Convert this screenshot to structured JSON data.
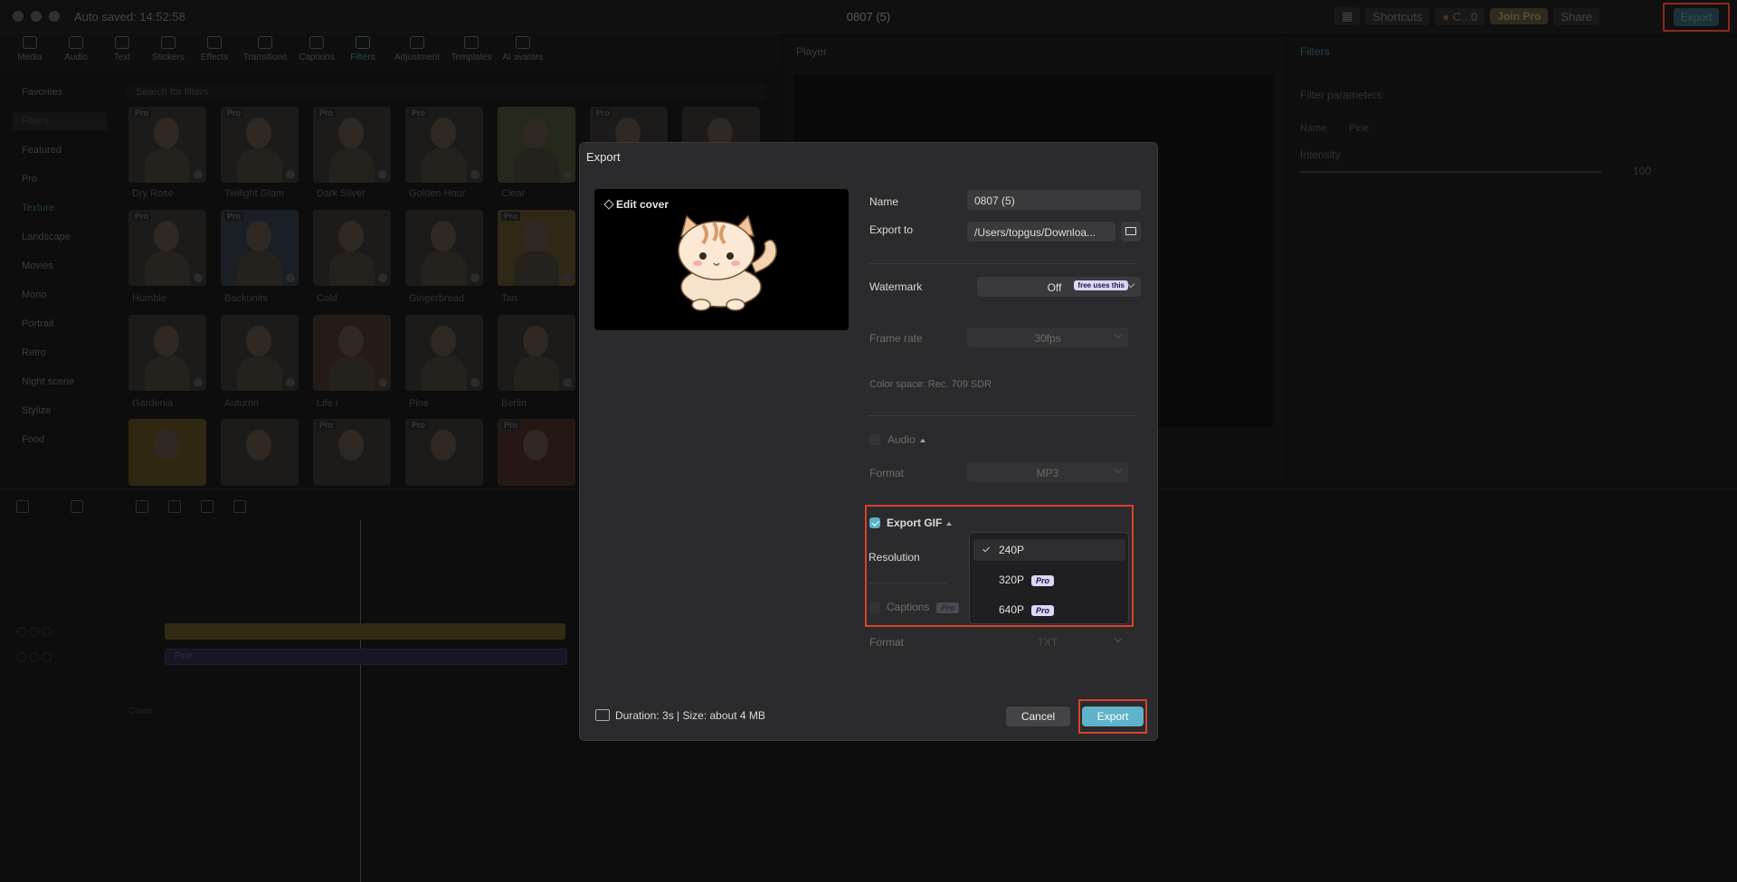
{
  "titlebar": {
    "autosave": "Auto saved: 14:52:58",
    "doc_title": "0807 (5)",
    "shortcuts": "Shortcuts",
    "user": "C...0",
    "join_pro": "Join Pro",
    "share": "Share",
    "export": "Export"
  },
  "toolbar": {
    "tools": [
      "Media",
      "Audio",
      "Text",
      "Stickers",
      "Effects",
      "Transitions",
      "Captions",
      "Filters",
      "Adjustment",
      "Templates",
      "AI avatars"
    ]
  },
  "sidebar": {
    "favorites": "Favorites",
    "filters": "Filters",
    "items": [
      "Featured",
      "Pro",
      "Texture",
      "Landscape",
      "Movies",
      "Mono",
      "Portrait",
      "Retro",
      "Night scene",
      "Stylize",
      "Food"
    ]
  },
  "search": {
    "placeholder": "Search for filters"
  },
  "filter_thumbs": {
    "labels": [
      "Dry Rose",
      "Twilight Glam",
      "Dark Silver",
      "Golden Hour",
      "Clear",
      "Humble",
      "Backunits",
      "Cold",
      "Gingerbread",
      "Tan",
      "Gardenia",
      "Autumn",
      "Life I",
      "Pine",
      "Berlin"
    ]
  },
  "player": {
    "title": "Player"
  },
  "right_panel": {
    "title": "Filters",
    "params": "Filter parameters",
    "name_label": "Name",
    "name_value": "Pine",
    "intensity_label": "Intensity",
    "intensity_value": "100"
  },
  "timeline": {
    "track_label": "Pine",
    "cover": "Cover"
  },
  "dialog": {
    "title": "Export",
    "edit_cover": "Edit cover",
    "name_label": "Name",
    "name_value": "0807 (5)",
    "export_to_label": "Export to",
    "export_to_value": "/Users/topgus/Downloa...",
    "watermark_label": "Watermark",
    "watermark_value": "Off",
    "free_badge": "free uses this",
    "frame_rate_label": "Frame rate",
    "frame_rate_value": "30fps",
    "color_space": "Color space: Rec. 709 SDR",
    "audio_label": "Audio",
    "audio_format_label": "Format",
    "audio_format_value": "MP3",
    "export_gif_label": "Export GIF",
    "resolution_label": "Resolution",
    "resolution_options": [
      "240P",
      "320P",
      "640P"
    ],
    "resolution_selected": "240P",
    "pro_badge": "Pro",
    "captions_label": "Captions",
    "captions_format_label": "Format",
    "captions_format_value": "TXT",
    "footer": "Duration: 3s | Size: about 4 MB",
    "cancel": "Cancel",
    "export": "Export"
  }
}
